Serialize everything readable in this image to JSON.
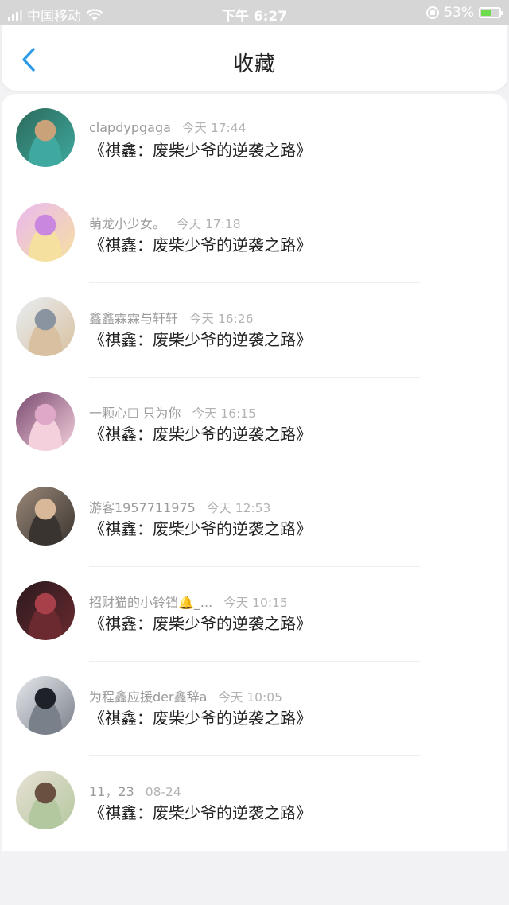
{
  "status_bar": {
    "carrier": "中国移动",
    "time": "下午 6:27",
    "battery_percent": "53%",
    "icons": [
      "signal-icon",
      "wifi-icon",
      "rotation-lock-icon",
      "battery-charging-icon"
    ]
  },
  "nav": {
    "title": "收藏",
    "back_icon": "chevron-left-icon"
  },
  "colors": {
    "accent": "#2c9bea",
    "status_bg": "#d6d6d6",
    "battery_fill": "#6edc4a"
  },
  "items": [
    {
      "user": "clapdypgaga",
      "time": "今天 17:44",
      "title": "《祺鑫：废柴少爷的逆袭之路》",
      "avatar_colors": [
        "#2b6a5a",
        "#c9a27a",
        "#3fa9a0"
      ]
    },
    {
      "user": "萌龙小少女。",
      "time": "今天 17:18",
      "title": "《祺鑫：废柴少爷的逆袭之路》",
      "avatar_colors": [
        "#e9b8f0",
        "#c987e0",
        "#f6e0a0"
      ]
    },
    {
      "user": "鑫鑫霖霖与轩轩",
      "time": "今天 16:26",
      "title": "《祺鑫：废柴少爷的逆袭之路》",
      "avatar_colors": [
        "#e8eef2",
        "#8a94a0",
        "#d9c0a0"
      ]
    },
    {
      "user": "一颗心☐  只为你",
      "time": "今天 16:15",
      "title": "《祺鑫：废柴少爷的逆袭之路》",
      "avatar_colors": [
        "#7a4a70",
        "#e0a8c8",
        "#f4d0dc"
      ]
    },
    {
      "user": "游客1957711975",
      "time": "今天 12:53",
      "title": "《祺鑫：废柴少爷的逆袭之路》",
      "avatar_colors": [
        "#9a8878",
        "#d8b898",
        "#3a3430"
      ]
    },
    {
      "user": "招财猫的小铃铛🔔_...",
      "time": "今天 10:15",
      "title": "《祺鑫：废柴少爷的逆袭之路》",
      "avatar_colors": [
        "#2a1a1e",
        "#a8404a",
        "#6a2a30"
      ]
    },
    {
      "user": "为程鑫应援der鑫辞a",
      "time": "今天 10:05",
      "title": "《祺鑫：废柴少爷的逆袭之路》",
      "avatar_colors": [
        "#e6e8ec",
        "#1e2228",
        "#7a808a"
      ]
    },
    {
      "user": "11，23",
      "time": "08-24",
      "title": "《祺鑫：废柴少爷的逆袭之路》",
      "avatar_colors": [
        "#e8e0d4",
        "#6a5040",
        "#b4c8a0"
      ]
    }
  ]
}
